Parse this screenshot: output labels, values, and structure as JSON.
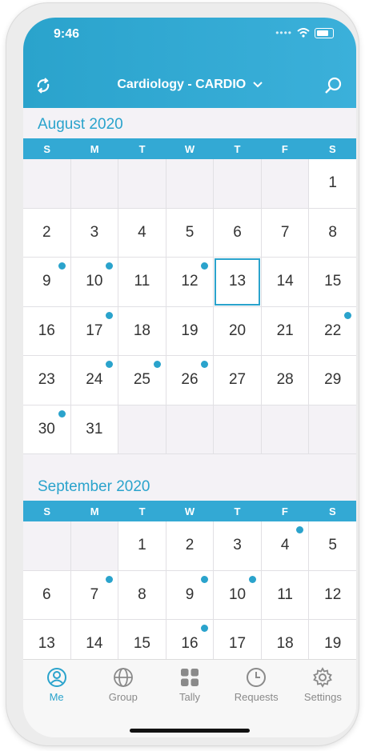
{
  "status": {
    "time": "9:46"
  },
  "header": {
    "title": "Cardiology - CARDIO"
  },
  "weekdays": [
    "S",
    "M",
    "T",
    "W",
    "T",
    "F",
    "S"
  ],
  "months": [
    {
      "name": "August 2020",
      "days": [
        {
          "d": ""
        },
        {
          "d": ""
        },
        {
          "d": ""
        },
        {
          "d": ""
        },
        {
          "d": ""
        },
        {
          "d": ""
        },
        {
          "d": "1"
        },
        {
          "d": "2"
        },
        {
          "d": "3"
        },
        {
          "d": "4"
        },
        {
          "d": "5"
        },
        {
          "d": "6"
        },
        {
          "d": "7"
        },
        {
          "d": "8"
        },
        {
          "d": "9",
          "dot": true
        },
        {
          "d": "10",
          "dot": true
        },
        {
          "d": "11"
        },
        {
          "d": "12",
          "dot": true
        },
        {
          "d": "13",
          "today": true
        },
        {
          "d": "14"
        },
        {
          "d": "15"
        },
        {
          "d": "16"
        },
        {
          "d": "17",
          "dot": true
        },
        {
          "d": "18"
        },
        {
          "d": "19"
        },
        {
          "d": "20"
        },
        {
          "d": "21"
        },
        {
          "d": "22",
          "dot": true
        },
        {
          "d": "23"
        },
        {
          "d": "24",
          "dot": true
        },
        {
          "d": "25",
          "dot": true
        },
        {
          "d": "26",
          "dot": true
        },
        {
          "d": "27"
        },
        {
          "d": "28"
        },
        {
          "d": "29"
        },
        {
          "d": "30",
          "dot": true
        },
        {
          "d": "31"
        },
        {
          "d": ""
        },
        {
          "d": ""
        },
        {
          "d": ""
        },
        {
          "d": ""
        },
        {
          "d": ""
        }
      ]
    },
    {
      "name": "September 2020",
      "days": [
        {
          "d": ""
        },
        {
          "d": ""
        },
        {
          "d": "1"
        },
        {
          "d": "2"
        },
        {
          "d": "3"
        },
        {
          "d": "4",
          "dot": true
        },
        {
          "d": "5"
        },
        {
          "d": "6"
        },
        {
          "d": "7",
          "dot": true
        },
        {
          "d": "8"
        },
        {
          "d": "9",
          "dot": true
        },
        {
          "d": "10",
          "dot": true
        },
        {
          "d": "11"
        },
        {
          "d": "12"
        },
        {
          "d": "13"
        },
        {
          "d": "14"
        },
        {
          "d": "15"
        },
        {
          "d": "16",
          "dot": true
        },
        {
          "d": "17"
        },
        {
          "d": "18"
        },
        {
          "d": "19"
        }
      ]
    }
  ],
  "tabs": [
    {
      "label": "Me",
      "icon": "person-icon",
      "active": true
    },
    {
      "label": "Group",
      "icon": "globe-icon"
    },
    {
      "label": "Tally",
      "icon": "grid-icon"
    },
    {
      "label": "Requests",
      "icon": "clock-icon"
    },
    {
      "label": "Settings",
      "icon": "gear-icon"
    }
  ],
  "colors": {
    "accent": "#2aa3cc",
    "header": "#33a9d4",
    "background": "#f4f2f6"
  }
}
